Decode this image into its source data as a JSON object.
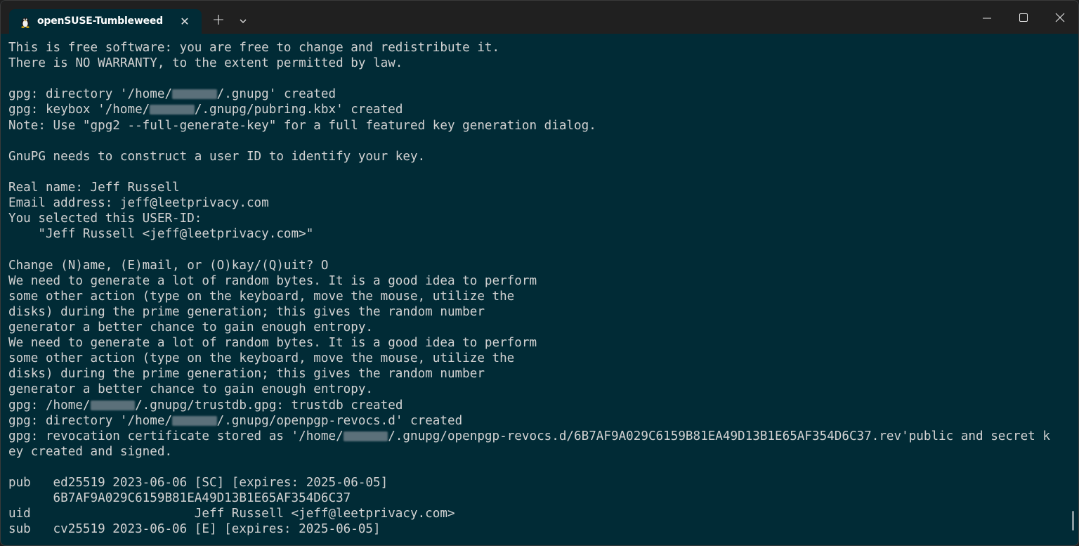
{
  "tab": {
    "title": "openSUSE-Tumbleweed",
    "icon": "tux-penguin-icon"
  },
  "colors": {
    "terminal_bg": "#012b36",
    "terminal_fg": "#d2d2d2",
    "titlebar_bg": "#202020"
  },
  "terminal": {
    "lines": [
      [
        {
          "t": "This is free software: you are free to change and redistribute it."
        }
      ],
      [
        {
          "t": "There is NO WARRANTY, to the extent permitted by law."
        }
      ],
      [
        {
          "t": ""
        }
      ],
      [
        {
          "t": "gpg: directory '/home/"
        },
        {
          "t": "      ",
          "redacted": true
        },
        {
          "t": "/.gnupg' created"
        }
      ],
      [
        {
          "t": "gpg: keybox '/home/"
        },
        {
          "t": "      ",
          "redacted": true
        },
        {
          "t": "/.gnupg/pubring.kbx' created"
        }
      ],
      [
        {
          "t": "Note: Use \"gpg2 --full-generate-key\" for a full featured key generation dialog."
        }
      ],
      [
        {
          "t": ""
        }
      ],
      [
        {
          "t": "GnuPG needs to construct a user ID to identify your key."
        }
      ],
      [
        {
          "t": ""
        }
      ],
      [
        {
          "t": "Real name: Jeff Russell"
        }
      ],
      [
        {
          "t": "Email address: jeff@leetprivacy.com"
        }
      ],
      [
        {
          "t": "You selected this USER-ID:"
        }
      ],
      [
        {
          "t": "    \"Jeff Russell <jeff@leetprivacy.com>\""
        }
      ],
      [
        {
          "t": ""
        }
      ],
      [
        {
          "t": "Change (N)ame, (E)mail, or (O)kay/(Q)uit? O"
        }
      ],
      [
        {
          "t": "We need to generate a lot of random bytes. It is a good idea to perform"
        }
      ],
      [
        {
          "t": "some other action (type on the keyboard, move the mouse, utilize the"
        }
      ],
      [
        {
          "t": "disks) during the prime generation; this gives the random number"
        }
      ],
      [
        {
          "t": "generator a better chance to gain enough entropy."
        }
      ],
      [
        {
          "t": "We need to generate a lot of random bytes. It is a good idea to perform"
        }
      ],
      [
        {
          "t": "some other action (type on the keyboard, move the mouse, utilize the"
        }
      ],
      [
        {
          "t": "disks) during the prime generation; this gives the random number"
        }
      ],
      [
        {
          "t": "generator a better chance to gain enough entropy."
        }
      ],
      [
        {
          "t": "gpg: /home/"
        },
        {
          "t": "      ",
          "redacted": true
        },
        {
          "t": "/.gnupg/trustdb.gpg: trustdb created"
        }
      ],
      [
        {
          "t": "gpg: directory '/home/"
        },
        {
          "t": "      ",
          "redacted": true
        },
        {
          "t": "/.gnupg/openpgp-revocs.d' created"
        }
      ],
      [
        {
          "t": "gpg: revocation certificate stored as '/home/"
        },
        {
          "t": "      ",
          "redacted": true
        },
        {
          "t": "/.gnupg/openpgp-revocs.d/6B7AF9A029C6159B81EA49D13B1E65AF354D6C37.rev'public and secret k"
        }
      ],
      [
        {
          "t": "ey created and signed."
        }
      ],
      [
        {
          "t": ""
        }
      ],
      [
        {
          "t": "pub   ed25519 2023-06-06 [SC] [expires: 2025-06-05]"
        }
      ],
      [
        {
          "t": "      6B7AF9A029C6159B81EA49D13B1E65AF354D6C37"
        }
      ],
      [
        {
          "t": "uid                      Jeff Russell <jeff@leetprivacy.com>"
        }
      ],
      [
        {
          "t": "sub   cv25519 2023-06-06 [E] [expires: 2025-06-05]"
        }
      ]
    ]
  }
}
